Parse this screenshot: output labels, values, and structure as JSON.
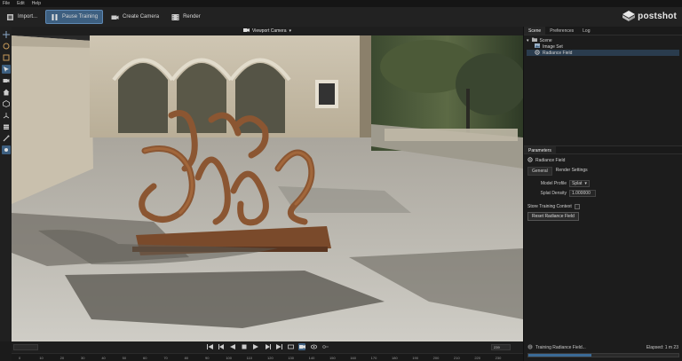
{
  "menu": [
    "File",
    "Edit",
    "Help"
  ],
  "toolbar": {
    "import_label": "Import...",
    "pause_label": "Pause Training",
    "create_camera_label": "Create Camera",
    "render_label": "Render"
  },
  "brand": {
    "name": "postshot",
    "color": "#e8e8e8"
  },
  "colors": {
    "accent": "#3d5f80",
    "progress": "#3b6a96"
  },
  "viewport": {
    "camera_label": "Viewport Camera"
  },
  "right_tabs": [
    {
      "label": "Scene",
      "active": true
    },
    {
      "label": "Preferences",
      "active": false
    },
    {
      "label": "Log",
      "active": false
    }
  ],
  "scene_tree": [
    {
      "label": "Scene",
      "icon": "folder-icon",
      "depth": 0
    },
    {
      "label": "Image Set",
      "icon": "image-icon",
      "depth": 1
    },
    {
      "label": "Radiance Field",
      "icon": "gear-icon",
      "depth": 1
    }
  ],
  "params": {
    "tab": "Parameters",
    "title": "Radiance Field",
    "subtabs": [
      "General",
      "Render Settings"
    ],
    "model_profile_label": "Model Profile",
    "model_profile_value": "Splat",
    "splat_density_label": "Splat Density",
    "splat_density_value": "1.000000",
    "store_context_label": "Store Training Context",
    "reset_button": "Reset Radiance Field"
  },
  "timeline": {
    "start": "0",
    "end": "239",
    "ticks": [
      "0",
      "10",
      "20",
      "30",
      "40",
      "50",
      "60",
      "70",
      "80",
      "90",
      "100",
      "110",
      "120",
      "130",
      "140",
      "150",
      "160",
      "170",
      "180",
      "190",
      "200",
      "210",
      "220",
      "230"
    ]
  },
  "status": {
    "label": "Training Radiance Field...",
    "elapsed": "Elapsed: 1 m 23",
    "progress": 0.42
  }
}
